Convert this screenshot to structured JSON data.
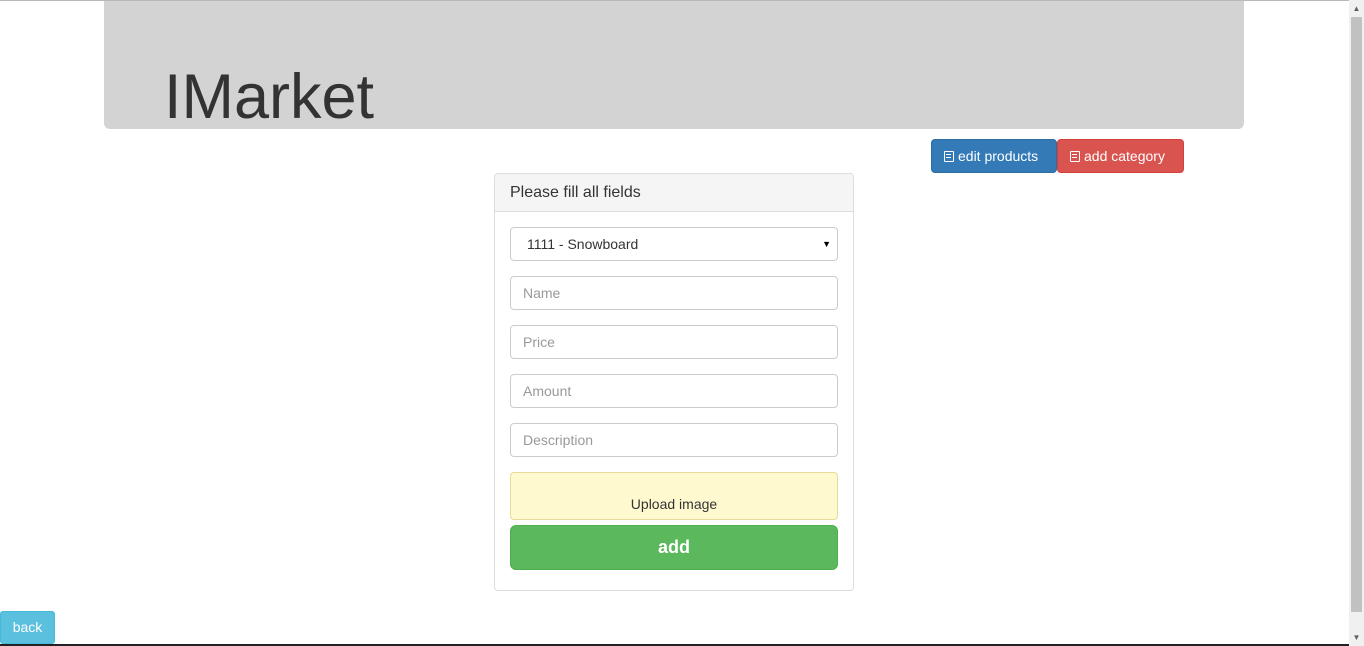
{
  "header": {
    "brand": "IMarket"
  },
  "toolbar": {
    "edit_products_label": "edit products",
    "add_category_label": "add category"
  },
  "form": {
    "heading": "Please fill all fields",
    "category_select": {
      "selected": "1111 - Snowboard"
    },
    "name_placeholder": "Name",
    "price_placeholder": "Price",
    "amount_placeholder": "Amount",
    "description_placeholder": "Description",
    "upload_label": "Upload image",
    "submit_label": "add"
  },
  "footer": {
    "back_label": "back"
  },
  "icons": {
    "edit_products": "list-alt-icon",
    "add_category": "list-alt-icon",
    "select_caret": "caret-down-icon",
    "scroll_up": "scroll-up-arrow-icon",
    "scroll_down": "scroll-down-arrow-icon"
  },
  "colors": {
    "jumbotron": "#d3d3d3",
    "primary": "#337ab7",
    "danger": "#d9534f",
    "success": "#5cb85c",
    "info": "#5bc0de",
    "upload_bg": "#fff9d0"
  }
}
